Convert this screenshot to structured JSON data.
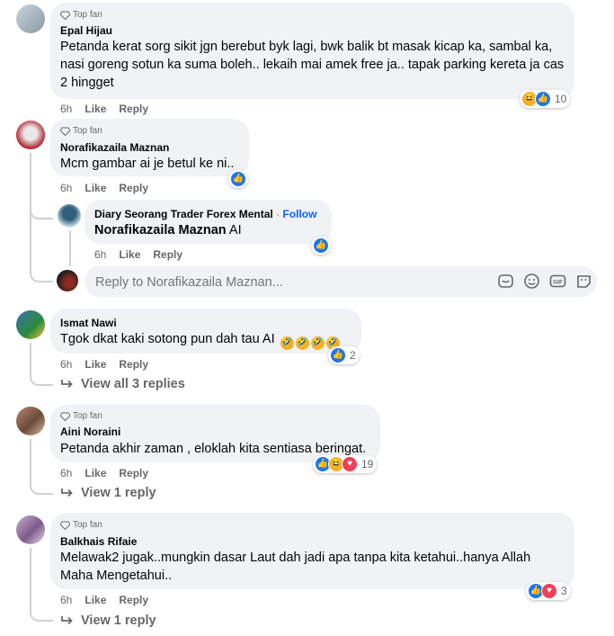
{
  "comments": [
    {
      "badge": "Top fan",
      "author": "Epal Hijau",
      "text": "Petanda kerat sorg sikit jgn berebut byk lagi, bwk balik bt masak kicap ka, sambal ka, nasi goreng sotun ka suma boleh.. lekaih mai amek free ja.. tapak parking kereta ja cas 2 hingget",
      "time": "6h",
      "like": "Like",
      "reply": "Reply",
      "reaction_count": "10"
    },
    {
      "badge": "Top fan",
      "author": "Norafikazaila Maznan",
      "text": "Mcm gambar ai je betul ke ni..",
      "time": "6h",
      "like": "Like",
      "reply": "Reply",
      "reply_item": {
        "author": "Diary Seorang Trader Forex Mental",
        "follow": "Follow",
        "mention": "Norafikazaila Maznan",
        "text": "AI",
        "time": "6h",
        "like": "Like",
        "reply": "Reply"
      },
      "reply_placeholder": "Reply to Norafikazaila Maznan..."
    },
    {
      "author": "Ismat Nawi",
      "text": "Tgok dkat kaki sotong pun dah tau AI",
      "time": "6h",
      "like": "Like",
      "reply": "Reply",
      "reaction_count": "2",
      "view_replies": "View all 3 replies"
    },
    {
      "badge": "Top fan",
      "author": "Aini Noraini",
      "text": "Petanda akhir zaman , eloklah kita sentiasa beringat.",
      "time": "6h",
      "like": "Like",
      "reply": "Reply",
      "reaction_count": "19",
      "view_replies": "View 1 reply"
    },
    {
      "badge": "Top fan",
      "author": "Balkhais Rifaie",
      "text": "Melawak2 jugak..mungkin dasar Laut dah jadi apa tanpa kita ketahui..hanya Allah Maha Mengetahui..",
      "time": "6h",
      "like": "Like",
      "reply": "Reply",
      "reaction_count": "3",
      "view_replies": "View 1 reply"
    }
  ],
  "icons": {
    "badge": "diamond-icon",
    "reply_box": [
      "sticker-icon",
      "emoji-icon",
      "gif-icon",
      "avatar-sticker-icon"
    ],
    "view_replies": "reply-arrow-icon",
    "reactions": [
      "like-reaction-icon",
      "haha-reaction-icon",
      "love-reaction-icon"
    ]
  },
  "colors": {
    "bubble": "#f0f2f5",
    "meta_text": "#65676b",
    "like_blue": "#1877f2",
    "haha_yellow": "#f7b125",
    "love_red": "#f33e58",
    "follow_blue": "#0866ff"
  }
}
